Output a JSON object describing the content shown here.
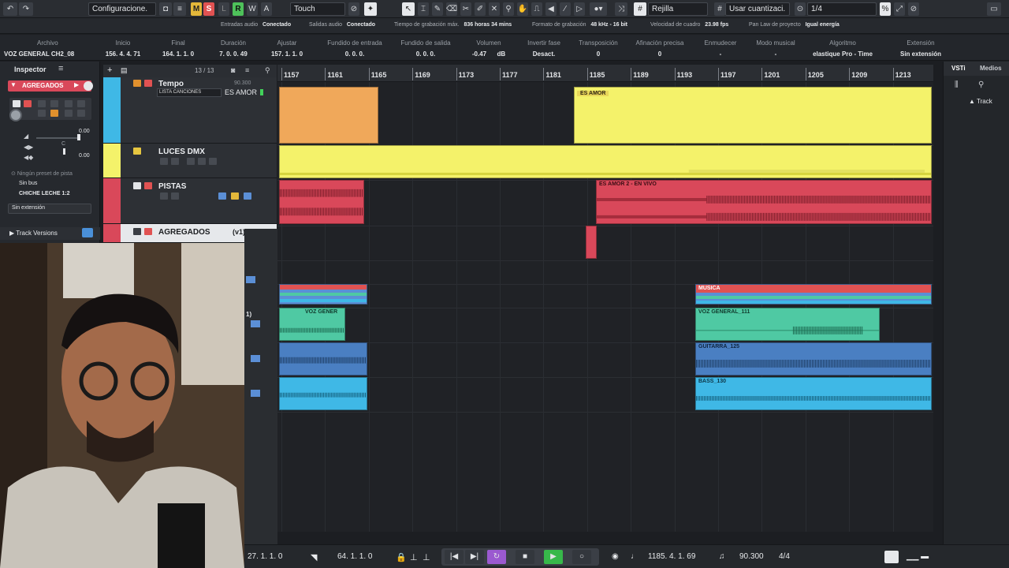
{
  "toolbar": {
    "config_label": "Configuracione.",
    "m": "M",
    "s": "S",
    "l": "L",
    "r": "R",
    "w": "W",
    "a": "A",
    "automation_mode": "Touch",
    "snap_type": "Rejilla",
    "quantize_mode": "Usar cuantizaci.",
    "quantize_value": "1/4"
  },
  "status": {
    "entradas": "Entradas audio",
    "entradas_val": "Conectado",
    "salidas": "Salidas audio",
    "salidas_val": "Conectado",
    "tiempo": "Tiempo de grabación máx.",
    "tiempo_val": "836 horas 34 mins",
    "formato": "Formato de grabación",
    "formato_val": "48 kHz - 16 bit",
    "velocidad": "Velocidad de cuadro",
    "velocidad_val": "23.98 fps",
    "panlaw": "Pan Law de proyecto",
    "panlaw_val": "Igual energía"
  },
  "infoline": [
    {
      "label": "Archivo",
      "value": "VOZ GENERAL CH2_08"
    },
    {
      "label": "Inicio",
      "value": "156. 4. 4. 71"
    },
    {
      "label": "Final",
      "value": "164. 1. 1. 0"
    },
    {
      "label": "Duración",
      "value": "7. 0. 0. 49"
    },
    {
      "label": "Ajustar",
      "value": "157. 1. 1. 0"
    },
    {
      "label": "Fundido de entrada",
      "value": "0. 0. 0."
    },
    {
      "label": "Fundido de salida",
      "value": "0. 0. 0."
    },
    {
      "label": "Volumen",
      "value": "-0.47",
      "unit": "dB"
    },
    {
      "label": "Invertir fase",
      "value": "Desact."
    },
    {
      "label": "Transposición",
      "value": "0"
    },
    {
      "label": "Afinación precisa",
      "value": "0"
    },
    {
      "label": "Enmudecer",
      "value": "-"
    },
    {
      "label": "Modo musical",
      "value": "-"
    },
    {
      "label": "Algoritmo",
      "value": "elastique Pro - Time"
    },
    {
      "label": "Extensión",
      "value": "Sin extensión"
    }
  ],
  "inspector": {
    "title": "Inspector",
    "track_name": "AGREGADOS",
    "vol_val": "0.00",
    "pan_val": "0.00",
    "pan_center": "C",
    "preset": "Ningún preset de pista",
    "bus": "Sin bus",
    "output": "CHICHE LECHE 1:2",
    "extension": "Sin extensión",
    "versions": "Track Versions"
  },
  "track_list": {
    "count": "13 / 13",
    "tracks": [
      {
        "name": "Tempo",
        "sub": "LISTA CANCIONES",
        "value": "ES AMOR",
        "tempo_val": "90.300"
      },
      {
        "name": "LUCES DMX"
      },
      {
        "name": "PISTAS"
      },
      {
        "name": "AGREGADOS",
        "version": "(v1)"
      }
    ]
  },
  "ruler": {
    "labels": [
      "1157",
      "1161",
      "1165",
      "1169",
      "1173",
      "1177",
      "1181",
      "1185",
      "1189",
      "1193",
      "1197",
      "1201",
      "1205",
      "1209",
      "1213"
    ]
  },
  "events": {
    "es_amor": "ES AMOR",
    "es_amor_vivo": "ES AMOR 2 - EN VIVO",
    "musica": "MUSICA",
    "voz_general_a": "VOZ GENER",
    "voz_general_b": "VOZ GENERAL_111",
    "guitarra": "GUITARRA_125",
    "bass": "BASS_130",
    "row_label": "1)"
  },
  "right_panel": {
    "tab1": "VSTi",
    "tab2": "Medios",
    "track": "Track"
  },
  "transport": {
    "left_pos": "27. 1. 1. 0",
    "right_pos": "64. 1. 1. 0",
    "position": "1185. 4. 1. 69",
    "tempo": "90.300",
    "signature": "4/4"
  },
  "colors": {
    "orange": "#f0a85a",
    "yellow": "#f4f26a",
    "red": "#d9485a",
    "teal": "#4fc9a3",
    "blue": "#4a7fc2",
    "cyan": "#3fb8e6"
  }
}
